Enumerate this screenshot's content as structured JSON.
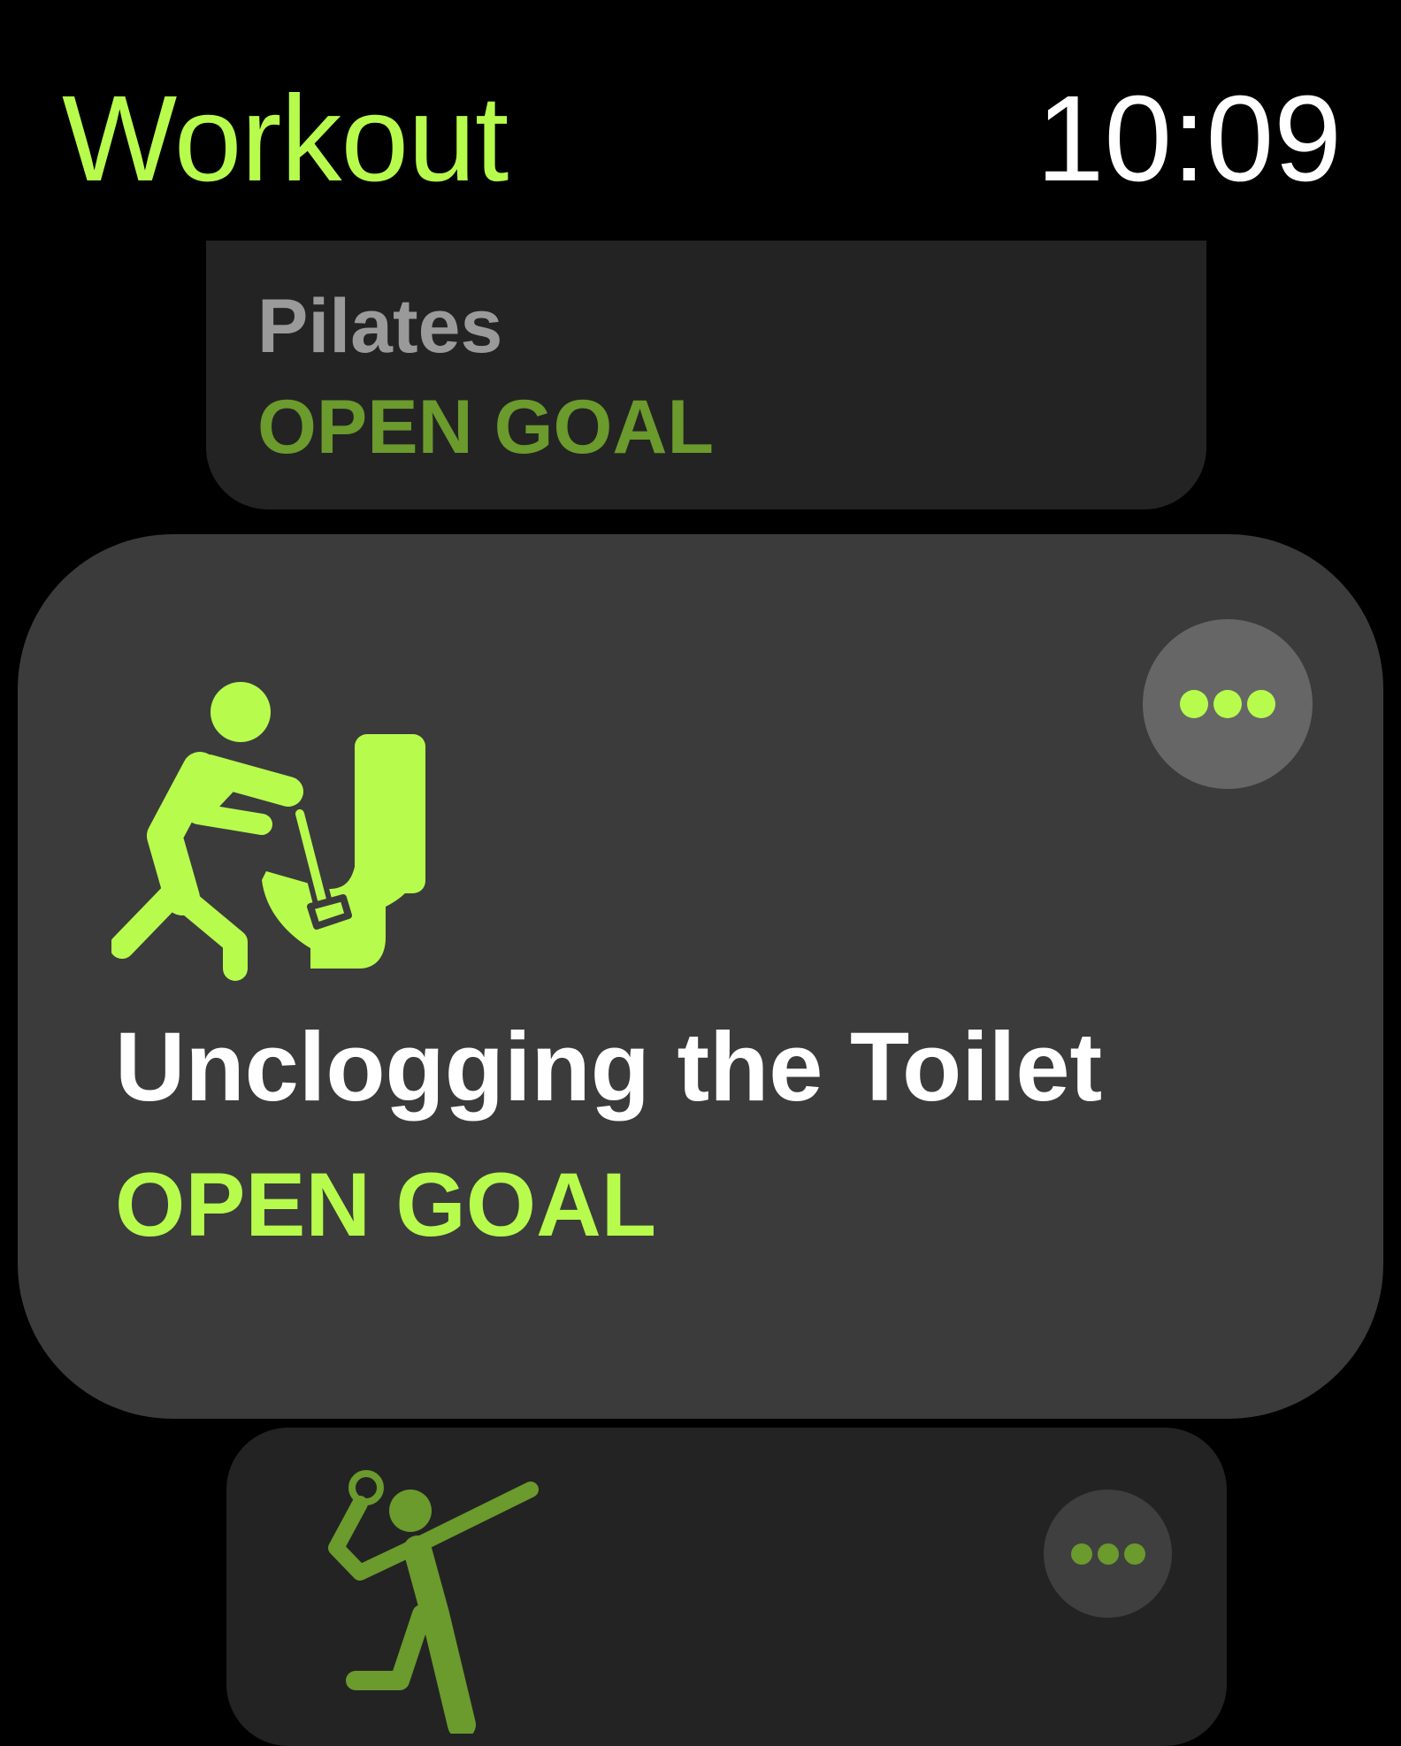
{
  "header": {
    "app_title": "Workout",
    "time": "10:09"
  },
  "colors": {
    "accent": "#b7fc4d",
    "accent_dim": "#6b9a2d",
    "background": "#000000",
    "card_selected": "#3b3b3b",
    "card_unselected": "#232323"
  },
  "workouts": [
    {
      "name": "Pilates",
      "goal": "OPEN GOAL",
      "icon": "pilates-icon",
      "selected": false
    },
    {
      "name": "Unclogging the Toilet",
      "goal": "OPEN GOAL",
      "icon": "plunger-toilet-icon",
      "selected": true
    },
    {
      "name": "",
      "goal": "",
      "icon": "volleyball-player-icon",
      "selected": false
    }
  ]
}
